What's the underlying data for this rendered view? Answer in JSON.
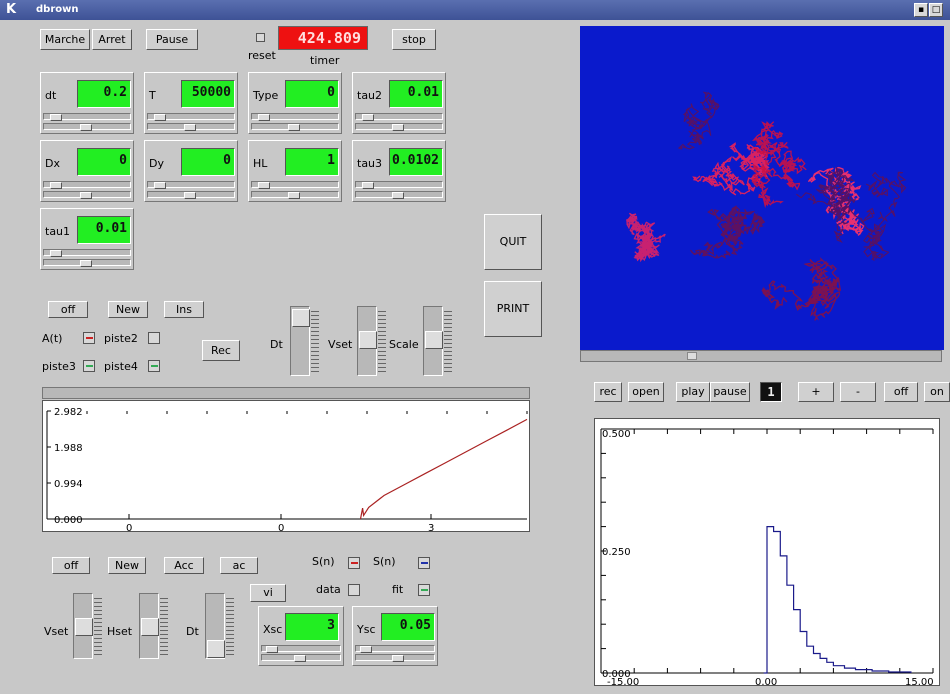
{
  "window": {
    "title": "dbrown",
    "logo": "K"
  },
  "top": {
    "marche": "Marche",
    "arret": "Arret",
    "pause": "Pause",
    "reset": "reset",
    "timer_value": "424.809",
    "timer_label": "timer",
    "stop": "stop"
  },
  "params": [
    {
      "label": "dt",
      "value": "0.2"
    },
    {
      "label": "T",
      "value": "50000"
    },
    {
      "label": "Type",
      "value": "0"
    },
    {
      "label": "tau2",
      "value": "0.01"
    },
    {
      "label": "Dx",
      "value": "0"
    },
    {
      "label": "Dy",
      "value": "0"
    },
    {
      "label": "HL",
      "value": "1"
    },
    {
      "label": "tau3",
      "value": "0.0102"
    },
    {
      "label": "tau1",
      "value": "0.01"
    }
  ],
  "side": {
    "quit": "QUIT",
    "print": "PRINT"
  },
  "mid": {
    "off": "off",
    "new": "New",
    "ins": "Ins",
    "rec": "Rec",
    "a_t": "A(t)",
    "piste2": "piste2",
    "piste3": "piste3",
    "piste4": "piste4",
    "dt": "Dt",
    "vset": "Vset",
    "scale": "Scale"
  },
  "bottom": {
    "off": "off",
    "new": "New",
    "acc": "Acc",
    "ac": "ac",
    "vi": "vi",
    "sn1": "S(n)",
    "sn2": "S(n)",
    "data": "data",
    "fit": "fit",
    "vset": "Vset",
    "hset": "Hset",
    "dt": "Dt",
    "xsc_label": "Xsc",
    "xsc_value": "3",
    "ysc_label": "Ysc",
    "ysc_value": "0.05"
  },
  "player": {
    "rec": "rec",
    "open": "open",
    "play": "play",
    "pause": "pause",
    "counter": "1",
    "plus": "+",
    "minus": "-",
    "off": "off",
    "on": "on"
  },
  "colors": {
    "trace": "#aa2222",
    "histogram": "#1a1a8a",
    "canvas_bg": "#0a1acc",
    "lcd": "#22ee22"
  },
  "chart_data": [
    {
      "type": "line",
      "y_ticks": [
        "2.982",
        "1.988",
        "0.994",
        "0.000"
      ],
      "x_ticks": [
        "0",
        "0",
        "3"
      ],
      "ylim": [
        0,
        2.982
      ],
      "series": [
        {
          "x": [
            3.07,
            3.09,
            3.1,
            3.15,
            3.3,
            3.5,
            3.7,
            3.9,
            4.1,
            4.3,
            4.5,
            4.7
          ],
          "values": [
            0.0,
            0.3,
            0.1,
            0.32,
            0.65,
            0.95,
            1.25,
            1.55,
            1.85,
            2.15,
            2.45,
            2.75
          ]
        }
      ]
    },
    {
      "type": "line",
      "y_ticks": [
        "0.500",
        "0.250",
        "0.000"
      ],
      "x_ticks": [
        "-15.00",
        "0.00",
        "15.00"
      ],
      "xlim": [
        -15,
        15
      ],
      "ylim": [
        0,
        0.5
      ],
      "series": [
        {
          "x": [
            -0.3,
            0,
            0.6,
            1.2,
            1.8,
            2.4,
            3.0,
            3.6,
            4.2,
            4.8,
            5.4,
            6.0,
            7.0,
            8.0,
            9.5,
            11,
            13
          ],
          "values": [
            0.0,
            0.3,
            0.29,
            0.24,
            0.18,
            0.13,
            0.085,
            0.055,
            0.04,
            0.03,
            0.022,
            0.015,
            0.01,
            0.007,
            0.004,
            0.002,
            0.0
          ]
        }
      ]
    }
  ]
}
